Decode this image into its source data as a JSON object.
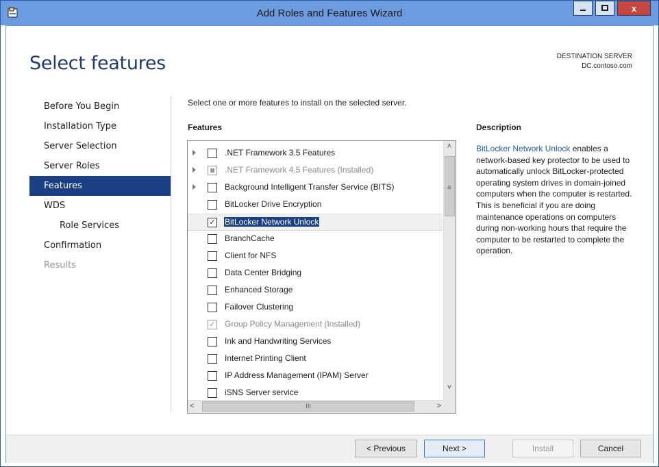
{
  "window": {
    "title": "Add Roles and Features Wizard",
    "close_label": "x",
    "accent_color": "#6d9be0",
    "selection_color": "#1b3f85",
    "link_color": "#1d5bb4"
  },
  "page": {
    "heading": "Select features",
    "destination_label": "DESTINATION SERVER",
    "destination_server": "DC.contoso.com"
  },
  "nav": {
    "items": [
      {
        "label": "Before You Begin",
        "state": "normal"
      },
      {
        "label": "Installation Type",
        "state": "normal"
      },
      {
        "label": "Server Selection",
        "state": "normal"
      },
      {
        "label": "Server Roles",
        "state": "normal"
      },
      {
        "label": "Features",
        "state": "active"
      },
      {
        "label": "WDS",
        "state": "normal"
      },
      {
        "label": "Role Services",
        "state": "sub"
      },
      {
        "label": "Confirmation",
        "state": "normal"
      },
      {
        "label": "Results",
        "state": "disabled"
      }
    ]
  },
  "main": {
    "intro": "Select one or more features to install on the selected server.",
    "features_header": "Features",
    "description_header": "Description",
    "features": [
      {
        "label": ".NET Framework 3.5 Features",
        "expandable": true,
        "checked": "none",
        "installed": false
      },
      {
        "label": ".NET Framework 4.5 Features (Installed)",
        "expandable": true,
        "checked": "partial",
        "installed": true
      },
      {
        "label": "Background Intelligent Transfer Service (BITS)",
        "expandable": true,
        "checked": "none",
        "installed": false
      },
      {
        "label": "BitLocker Drive Encryption",
        "expandable": false,
        "checked": "none",
        "installed": false
      },
      {
        "label": "BitLocker Network Unlock",
        "expandable": false,
        "checked": "checked",
        "installed": false,
        "selected": true
      },
      {
        "label": "BranchCache",
        "expandable": false,
        "checked": "none",
        "installed": false
      },
      {
        "label": "Client for NFS",
        "expandable": false,
        "checked": "none",
        "installed": false
      },
      {
        "label": "Data Center Bridging",
        "expandable": false,
        "checked": "none",
        "installed": false
      },
      {
        "label": "Enhanced Storage",
        "expandable": false,
        "checked": "none",
        "installed": false
      },
      {
        "label": "Failover Clustering",
        "expandable": false,
        "checked": "none",
        "installed": false
      },
      {
        "label": "Group Policy Management (Installed)",
        "expandable": false,
        "checked": "checked",
        "installed": true
      },
      {
        "label": "Ink and Handwriting Services",
        "expandable": false,
        "checked": "none",
        "installed": false
      },
      {
        "label": "Internet Printing Client",
        "expandable": false,
        "checked": "none",
        "installed": false
      },
      {
        "label": "IP Address Management (IPAM) Server",
        "expandable": false,
        "checked": "none",
        "installed": false
      },
      {
        "label": "iSNS Server service",
        "expandable": false,
        "checked": "none",
        "installed": false
      }
    ],
    "description_link": "BitLocker Network Unlock",
    "description_text": " enables a network-based key protector to be used to automatically unlock BitLocker-protected operating system drives in domain-joined computers when the computer is restarted. This is beneficial if you are doing maintenance operations on computers during non-working hours that require the computer to be restarted to complete the operation."
  },
  "footer": {
    "previous_label": "< Previous",
    "next_label": "Next >",
    "install_label": "Install",
    "cancel_label": "Cancel"
  }
}
